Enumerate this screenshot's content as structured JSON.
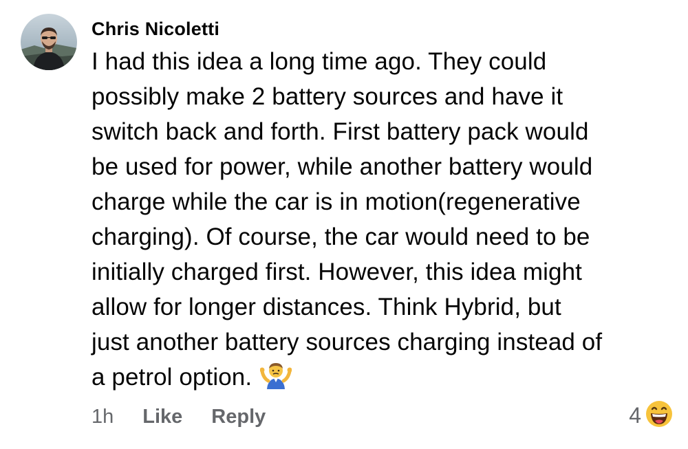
{
  "comment": {
    "author": "Chris Nicoletti",
    "text": "I had this idea a long time ago. They could\npossibly make 2 battery sources and have it\nswitch back and forth. First battery pack would\nbe used for power, while another battery would\ncharge while the car is in motion(regenerative\ncharging). Of course, the car would need to be\ninitially charged first. However, this idea might\nallow for longer distances. Think Hybrid, but\njust another battery sources charging instead of\na petrol option.",
    "emoji": "person-shrugging-icon",
    "timestamp": "1h",
    "like_label": "Like",
    "reply_label": "Reply",
    "reaction_count": "4",
    "reaction_icon": "haha-face-icon"
  },
  "colors": {
    "text": "#050505",
    "secondary": "#65676b",
    "reaction_yellow": "#f7c33b"
  }
}
